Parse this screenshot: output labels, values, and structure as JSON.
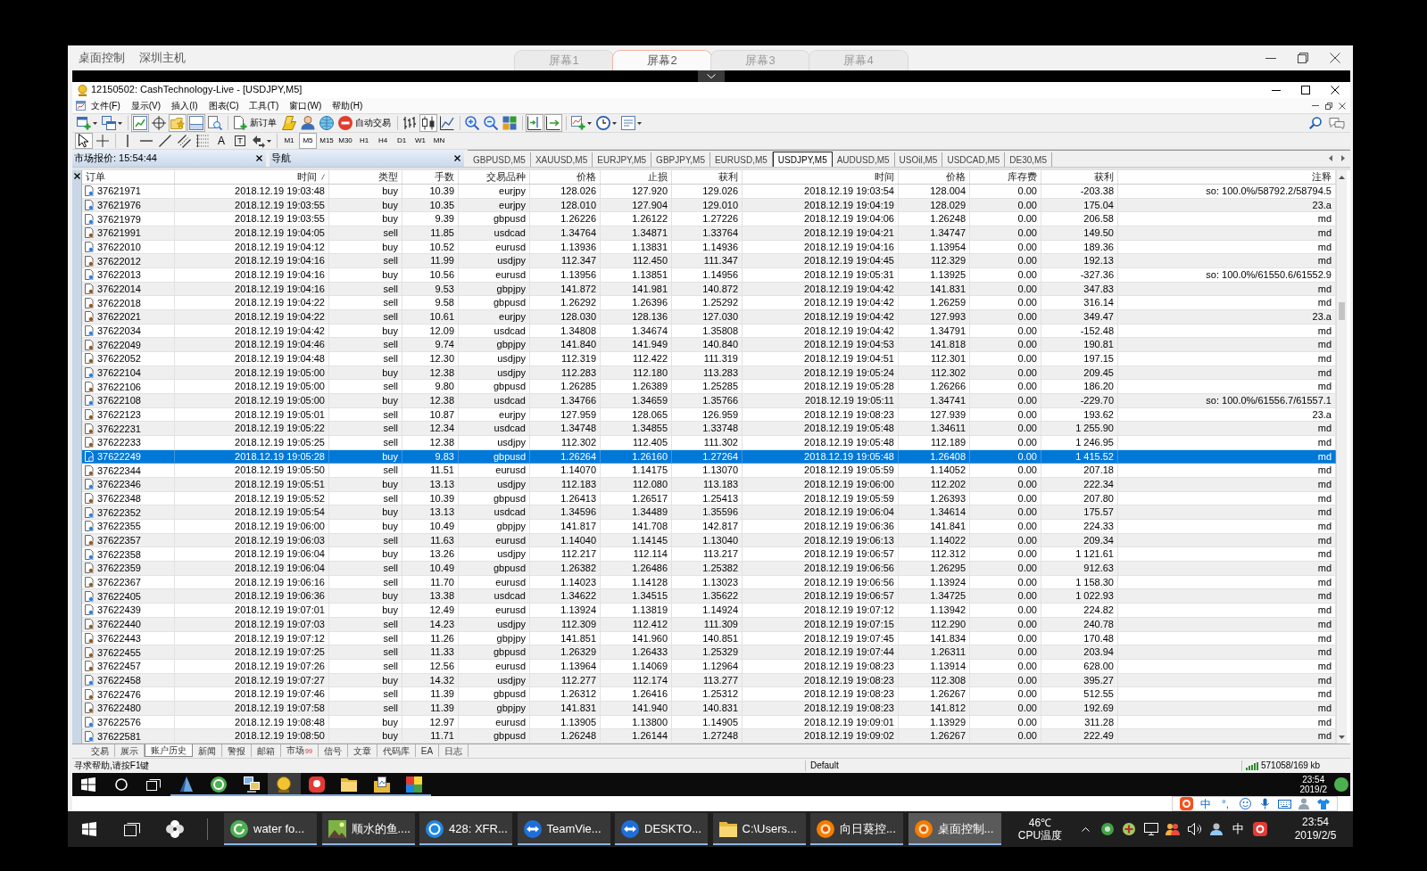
{
  "client": {
    "labels": [
      "桌面控制",
      "深圳主机"
    ],
    "screens": [
      {
        "label": "屏幕1",
        "selected": false
      },
      {
        "label": "屏幕2",
        "selected": true
      },
      {
        "label": "屏幕3",
        "selected": false
      },
      {
        "label": "屏幕4",
        "selected": false
      }
    ]
  },
  "window": {
    "title": "12150502: CashTechnology-Live - [USDJPY,M5]"
  },
  "menu": [
    "文件(F)",
    "显示(V)",
    "插入(I)",
    "图表(C)",
    "工具(T)",
    "窗口(W)",
    "帮助(H)"
  ],
  "toolbar": [
    {
      "pressed": false
    },
    {
      "pressed": false
    },
    {
      "pressed": true
    },
    {
      "pressed": false
    },
    {
      "pressed": true
    },
    {
      "pressed": true
    },
    {
      "pressed": false
    },
    {
      "label": "新订单",
      "pressed": false
    },
    {
      "pressed": false
    },
    {
      "pressed": false
    },
    {
      "pressed": false
    },
    {
      "label": "自动交易",
      "pressed": false
    },
    {
      "pressed": false
    },
    {
      "pressed": true
    },
    {
      "pressed": false
    },
    {
      "pressed": false
    },
    {
      "pressed": false
    },
    {
      "pressed": false
    },
    {
      "pressed": true
    },
    {
      "pressed": true
    },
    {
      "pressed": false
    },
    {
      "pressed": false
    },
    {
      "pressed": false
    }
  ],
  "drawing_tools": [
    {
      "pressed": true
    },
    {
      "pressed": false
    },
    {
      "pressed": false
    },
    {
      "pressed": false
    },
    {
      "pressed": false
    },
    {
      "pressed": false
    },
    {
      "pressed": false
    },
    {
      "glyph": "A",
      "pressed": false
    },
    {
      "glyph": "T",
      "pressed": false
    },
    {
      "pressed": false
    }
  ],
  "timeframes": [
    {
      "label": "M1",
      "selected": false
    },
    {
      "label": "M5",
      "selected": true
    },
    {
      "label": "M15",
      "selected": false
    },
    {
      "label": "M30",
      "selected": false
    },
    {
      "label": "H1",
      "selected": false
    },
    {
      "label": "H4",
      "selected": false
    },
    {
      "label": "D1",
      "selected": false
    },
    {
      "label": "W1",
      "selected": false
    },
    {
      "label": "MN",
      "selected": false
    }
  ],
  "panels": [
    {
      "title": "市场报价: 15:54:44"
    },
    {
      "title": "导航"
    }
  ],
  "chart_tabs": [
    {
      "label": "GBPUSD,M5",
      "selected": false
    },
    {
      "label": "XAUUSD,M5",
      "selected": false
    },
    {
      "label": "EURJPY,M5",
      "selected": false
    },
    {
      "label": "GBPJPY,M5",
      "selected": false
    },
    {
      "label": "EURUSD,M5",
      "selected": false
    },
    {
      "label": "USDJPY,M5",
      "selected": true
    },
    {
      "label": "AUDUSD,M5",
      "selected": false
    },
    {
      "label": "USOil,M5",
      "selected": false
    },
    {
      "label": "USDCAD,M5",
      "selected": false
    },
    {
      "label": "DE30,M5",
      "selected": false
    }
  ],
  "table": {
    "columns": [
      {
        "label": "订单",
        "sorted": false
      },
      {
        "label": "时间",
        "sorted": true
      },
      {
        "label": "类型",
        "sorted": false
      },
      {
        "label": "手数",
        "sorted": false
      },
      {
        "label": "交易品种",
        "sorted": false
      },
      {
        "label": "价格",
        "sorted": false
      },
      {
        "label": "止损",
        "sorted": false
      },
      {
        "label": "获利",
        "sorted": false
      },
      {
        "label": "时间",
        "sorted": false
      },
      {
        "label": "价格",
        "sorted": false
      },
      {
        "label": "库存费",
        "sorted": false
      },
      {
        "label": "获利",
        "sorted": false
      },
      {
        "label": "注释",
        "sorted": false
      }
    ],
    "rows": [
      {
        "kind": "buy",
        "selected": false,
        "cells": [
          "37621971",
          "2018.12.19 19:03:48",
          "buy",
          "10.39",
          "eurjpy",
          "128.026",
          "127.920",
          "129.026",
          "2018.12.19 19:03:54",
          "128.004",
          "0.00",
          "-203.38",
          "so: 100.0%/58792.2/58794.5"
        ]
      },
      {
        "kind": "buy",
        "selected": false,
        "cells": [
          "37621976",
          "2018.12.19 19:03:55",
          "buy",
          "10.35",
          "eurjpy",
          "128.010",
          "127.904",
          "129.010",
          "2018.12.19 19:04:19",
          "128.029",
          "0.00",
          "175.04",
          "23.a"
        ]
      },
      {
        "kind": "buy",
        "selected": false,
        "cells": [
          "37621979",
          "2018.12.19 19:03:55",
          "buy",
          "9.39",
          "gbpusd",
          "1.26226",
          "1.26122",
          "1.27226",
          "2018.12.19 19:04:06",
          "1.26248",
          "0.00",
          "206.58",
          "md"
        ]
      },
      {
        "kind": "sell",
        "selected": false,
        "cells": [
          "37621991",
          "2018.12.19 19:04:05",
          "sell",
          "11.85",
          "usdcad",
          "1.34764",
          "1.34871",
          "1.33764",
          "2018.12.19 19:04:21",
          "1.34747",
          "0.00",
          "149.50",
          "md"
        ]
      },
      {
        "kind": "buy",
        "selected": false,
        "cells": [
          "37622010",
          "2018.12.19 19:04:12",
          "buy",
          "10.52",
          "eurusd",
          "1.13936",
          "1.13831",
          "1.14936",
          "2018.12.19 19:04:16",
          "1.13954",
          "0.00",
          "189.36",
          "md"
        ]
      },
      {
        "kind": "sell",
        "selected": false,
        "cells": [
          "37622012",
          "2018.12.19 19:04:16",
          "sell",
          "11.99",
          "usdjpy",
          "112.347",
          "112.450",
          "111.347",
          "2018.12.19 19:04:45",
          "112.329",
          "0.00",
          "192.13",
          "md"
        ]
      },
      {
        "kind": "buy",
        "selected": false,
        "cells": [
          "37622013",
          "2018.12.19 19:04:16",
          "buy",
          "10.56",
          "eurusd",
          "1.13956",
          "1.13851",
          "1.14956",
          "2018.12.19 19:05:31",
          "1.13925",
          "0.00",
          "-327.36",
          "so: 100.0%/61550.6/61552.9"
        ]
      },
      {
        "kind": "sell",
        "selected": false,
        "cells": [
          "37622014",
          "2018.12.19 19:04:16",
          "sell",
          "9.53",
          "gbpjpy",
          "141.872",
          "141.981",
          "140.872",
          "2018.12.19 19:04:42",
          "141.831",
          "0.00",
          "347.83",
          "md"
        ]
      },
      {
        "kind": "sell",
        "selected": false,
        "cells": [
          "37622018",
          "2018.12.19 19:04:22",
          "sell",
          "9.58",
          "gbpusd",
          "1.26292",
          "1.26396",
          "1.25292",
          "2018.12.19 19:04:42",
          "1.26259",
          "0.00",
          "316.14",
          "md"
        ]
      },
      {
        "kind": "sell",
        "selected": false,
        "cells": [
          "37622021",
          "2018.12.19 19:04:22",
          "sell",
          "10.61",
          "eurjpy",
          "128.030",
          "128.136",
          "127.030",
          "2018.12.19 19:04:42",
          "127.993",
          "0.00",
          "349.47",
          "23.a"
        ]
      },
      {
        "kind": "buy",
        "selected": false,
        "cells": [
          "37622034",
          "2018.12.19 19:04:42",
          "buy",
          "12.09",
          "usdcad",
          "1.34808",
          "1.34674",
          "1.35808",
          "2018.12.19 19:04:42",
          "1.34791",
          "0.00",
          "-152.48",
          "md"
        ]
      },
      {
        "kind": "sell",
        "selected": false,
        "cells": [
          "37622049",
          "2018.12.19 19:04:46",
          "sell",
          "9.74",
          "gbpjpy",
          "141.840",
          "141.949",
          "140.840",
          "2018.12.19 19:04:53",
          "141.818",
          "0.00",
          "190.81",
          "md"
        ]
      },
      {
        "kind": "sell",
        "selected": false,
        "cells": [
          "37622052",
          "2018.12.19 19:04:48",
          "sell",
          "12.30",
          "usdjpy",
          "112.319",
          "112.422",
          "111.319",
          "2018.12.19 19:04:51",
          "112.301",
          "0.00",
          "197.15",
          "md"
        ]
      },
      {
        "kind": "buy",
        "selected": false,
        "cells": [
          "37622104",
          "2018.12.19 19:05:00",
          "buy",
          "12.38",
          "usdjpy",
          "112.283",
          "112.180",
          "113.283",
          "2018.12.19 19:05:24",
          "112.302",
          "0.00",
          "209.45",
          "md"
        ]
      },
      {
        "kind": "sell",
        "selected": false,
        "cells": [
          "37622106",
          "2018.12.19 19:05:00",
          "sell",
          "9.80",
          "gbpusd",
          "1.26285",
          "1.26389",
          "1.25285",
          "2018.12.19 19:05:28",
          "1.26266",
          "0.00",
          "186.20",
          "md"
        ]
      },
      {
        "kind": "buy",
        "selected": false,
        "cells": [
          "37622108",
          "2018.12.19 19:05:00",
          "buy",
          "12.38",
          "usdcad",
          "1.34766",
          "1.34659",
          "1.35766",
          "2018.12.19 19:05:11",
          "1.34741",
          "0.00",
          "-229.70",
          "so: 100.0%/61556.7/61557.1"
        ]
      },
      {
        "kind": "sell",
        "selected": false,
        "cells": [
          "37622123",
          "2018.12.19 19:05:01",
          "sell",
          "10.87",
          "eurjpy",
          "127.959",
          "128.065",
          "126.959",
          "2018.12.19 19:08:23",
          "127.939",
          "0.00",
          "193.62",
          "23.a"
        ]
      },
      {
        "kind": "sell",
        "selected": false,
        "cells": [
          "37622231",
          "2018.12.19 19:05:22",
          "sell",
          "12.34",
          "usdcad",
          "1.34748",
          "1.34855",
          "1.33748",
          "2018.12.19 19:05:48",
          "1.34611",
          "0.00",
          "1 255.90",
          "md"
        ]
      },
      {
        "kind": "sell",
        "selected": false,
        "cells": [
          "37622233",
          "2018.12.19 19:05:25",
          "sell",
          "12.38",
          "usdjpy",
          "112.302",
          "112.405",
          "111.302",
          "2018.12.19 19:05:48",
          "112.189",
          "0.00",
          "1 246.95",
          "md"
        ]
      },
      {
        "kind": "buy",
        "selected": true,
        "cells": [
          "37622249",
          "2018.12.19 19:05:28",
          "buy",
          "9.83",
          "gbpusd",
          "1.26264",
          "1.26160",
          "1.27264",
          "2018.12.19 19:05:48",
          "1.26408",
          "0.00",
          "1 415.52",
          "md"
        ]
      },
      {
        "kind": "sell",
        "selected": false,
        "cells": [
          "37622344",
          "2018.12.19 19:05:50",
          "sell",
          "11.51",
          "eurusd",
          "1.14070",
          "1.14175",
          "1.13070",
          "2018.12.19 19:05:59",
          "1.14052",
          "0.00",
          "207.18",
          "md"
        ]
      },
      {
        "kind": "buy",
        "selected": false,
        "cells": [
          "37622346",
          "2018.12.19 19:05:51",
          "buy",
          "13.13",
          "usdjpy",
          "112.183",
          "112.080",
          "113.183",
          "2018.12.19 19:06:00",
          "112.202",
          "0.00",
          "222.34",
          "md"
        ]
      },
      {
        "kind": "sell",
        "selected": false,
        "cells": [
          "37622348",
          "2018.12.19 19:05:52",
          "sell",
          "10.39",
          "gbpusd",
          "1.26413",
          "1.26517",
          "1.25413",
          "2018.12.19 19:05:59",
          "1.26393",
          "0.00",
          "207.80",
          "md"
        ]
      },
      {
        "kind": "buy",
        "selected": false,
        "cells": [
          "37622352",
          "2018.12.19 19:05:54",
          "buy",
          "13.13",
          "usdcad",
          "1.34596",
          "1.34489",
          "1.35596",
          "2018.12.19 19:06:04",
          "1.34614",
          "0.00",
          "175.57",
          "md"
        ]
      },
      {
        "kind": "buy",
        "selected": false,
        "cells": [
          "37622355",
          "2018.12.19 19:06:00",
          "buy",
          "10.49",
          "gbpjpy",
          "141.817",
          "141.708",
          "142.817",
          "2018.12.19 19:06:36",
          "141.841",
          "0.00",
          "224.33",
          "md"
        ]
      },
      {
        "kind": "sell",
        "selected": false,
        "cells": [
          "37622357",
          "2018.12.19 19:06:03",
          "sell",
          "11.63",
          "eurusd",
          "1.14040",
          "1.14145",
          "1.13040",
          "2018.12.19 19:06:13",
          "1.14022",
          "0.00",
          "209.34",
          "md"
        ]
      },
      {
        "kind": "buy",
        "selected": false,
        "cells": [
          "37622358",
          "2018.12.19 19:06:04",
          "buy",
          "13.26",
          "usdjpy",
          "112.217",
          "112.114",
          "113.217",
          "2018.12.19 19:06:57",
          "112.312",
          "0.00",
          "1 121.61",
          "md"
        ]
      },
      {
        "kind": "sell",
        "selected": false,
        "cells": [
          "37622359",
          "2018.12.19 19:06:04",
          "sell",
          "10.49",
          "gbpusd",
          "1.26382",
          "1.26486",
          "1.25382",
          "2018.12.19 19:06:56",
          "1.26295",
          "0.00",
          "912.63",
          "md"
        ]
      },
      {
        "kind": "sell",
        "selected": false,
        "cells": [
          "37622367",
          "2018.12.19 19:06:16",
          "sell",
          "11.70",
          "eurusd",
          "1.14023",
          "1.14128",
          "1.13023",
          "2018.12.19 19:06:56",
          "1.13924",
          "0.00",
          "1 158.30",
          "md"
        ]
      },
      {
        "kind": "buy",
        "selected": false,
        "cells": [
          "37622405",
          "2018.12.19 19:06:36",
          "buy",
          "13.38",
          "usdcad",
          "1.34622",
          "1.34515",
          "1.35622",
          "2018.12.19 19:06:57",
          "1.34725",
          "0.00",
          "1 022.93",
          "md"
        ]
      },
      {
        "kind": "buy",
        "selected": false,
        "cells": [
          "37622439",
          "2018.12.19 19:07:01",
          "buy",
          "12.49",
          "eurusd",
          "1.13924",
          "1.13819",
          "1.14924",
          "2018.12.19 19:07:12",
          "1.13942",
          "0.00",
          "224.82",
          "md"
        ]
      },
      {
        "kind": "sell",
        "selected": false,
        "cells": [
          "37622440",
          "2018.12.19 19:07:03",
          "sell",
          "14.23",
          "usdjpy",
          "112.309",
          "112.412",
          "111.309",
          "2018.12.19 19:07:15",
          "112.290",
          "0.00",
          "240.78",
          "md"
        ]
      },
      {
        "kind": "sell",
        "selected": false,
        "cells": [
          "37622443",
          "2018.12.19 19:07:12",
          "sell",
          "11.26",
          "gbpjpy",
          "141.851",
          "141.960",
          "140.851",
          "2018.12.19 19:07:45",
          "141.834",
          "0.00",
          "170.48",
          "md"
        ]
      },
      {
        "kind": "sell",
        "selected": false,
        "cells": [
          "37622455",
          "2018.12.19 19:07:25",
          "sell",
          "11.33",
          "gbpusd",
          "1.26329",
          "1.26433",
          "1.25329",
          "2018.12.19 19:07:44",
          "1.26311",
          "0.00",
          "203.94",
          "md"
        ]
      },
      {
        "kind": "sell",
        "selected": false,
        "cells": [
          "37622457",
          "2018.12.19 19:07:26",
          "sell",
          "12.56",
          "eurusd",
          "1.13964",
          "1.14069",
          "1.12964",
          "2018.12.19 19:08:23",
          "1.13914",
          "0.00",
          "628.00",
          "md"
        ]
      },
      {
        "kind": "buy",
        "selected": false,
        "cells": [
          "37622458",
          "2018.12.19 19:07:27",
          "buy",
          "14.32",
          "usdjpy",
          "112.277",
          "112.174",
          "113.277",
          "2018.12.19 19:08:23",
          "112.308",
          "0.00",
          "395.27",
          "md"
        ]
      },
      {
        "kind": "sell",
        "selected": false,
        "cells": [
          "37622476",
          "2018.12.19 19:07:46",
          "sell",
          "11.39",
          "gbpusd",
          "1.26312",
          "1.26416",
          "1.25312",
          "2018.12.19 19:08:23",
          "1.26267",
          "0.00",
          "512.55",
          "md"
        ]
      },
      {
        "kind": "sell",
        "selected": false,
        "cells": [
          "37622480",
          "2018.12.19 19:07:58",
          "sell",
          "11.39",
          "gbpjpy",
          "141.831",
          "141.940",
          "140.831",
          "2018.12.19 19:08:23",
          "141.812",
          "0.00",
          "192.69",
          "md"
        ]
      },
      {
        "kind": "buy",
        "selected": false,
        "cells": [
          "37622576",
          "2018.12.19 19:08:48",
          "buy",
          "12.97",
          "eurusd",
          "1.13905",
          "1.13800",
          "1.14905",
          "2018.12.19 19:09:01",
          "1.13929",
          "0.00",
          "311.28",
          "md"
        ]
      },
      {
        "kind": "buy",
        "selected": false,
        "cells": [
          "37622581",
          "2018.12.19 19:08:50",
          "buy",
          "11.71",
          "gbpusd",
          "1.26248",
          "1.26144",
          "1.27248",
          "2018.12.19 19:09:02",
          "1.26267",
          "0.00",
          "222.49",
          "md"
        ]
      }
    ]
  },
  "terminal_tabs": [
    {
      "label": "交易",
      "selected": false
    },
    {
      "label": "展示",
      "selected": false
    },
    {
      "label": "账户历史",
      "selected": true
    },
    {
      "label": "新闻",
      "selected": false
    },
    {
      "label": "警报",
      "selected": false
    },
    {
      "label": "邮箱",
      "selected": false
    },
    {
      "label": "市场",
      "badge": "99",
      "selected": false
    },
    {
      "label": "信号",
      "selected": false
    },
    {
      "label": "文章",
      "selected": false
    },
    {
      "label": "代码库",
      "selected": false
    },
    {
      "label": "EA",
      "selected": false
    },
    {
      "label": "日志",
      "selected": false
    }
  ],
  "status_bar": {
    "hint": "寻求帮助,请按F1键",
    "profile": "Default",
    "traffic": "571058/169 kb"
  },
  "remote_taskbar": {
    "apps": [
      {
        "running": true,
        "selected": false
      },
      {
        "running": true,
        "selected": false
      },
      {
        "running": true,
        "selected": false
      },
      {
        "running": true,
        "selected": true
      },
      {
        "running": true,
        "selected": false
      },
      {
        "running": true,
        "selected": false
      },
      {
        "running": true,
        "selected": false
      },
      {
        "running": true,
        "selected": false
      }
    ],
    "time": "23:54",
    "date": "2019/2"
  },
  "ime_bar": {
    "mode": "中",
    "punctuation": "°,"
  },
  "taskbar": {
    "buttons": [
      {
        "label": "water fo...",
        "selected": false
      },
      {
        "label": "顺水的鱼....",
        "selected": false
      },
      {
        "label": "428: XFR...",
        "selected": false
      },
      {
        "label": "TeamVie...",
        "selected": false
      },
      {
        "label": "DESKTO...",
        "selected": false
      },
      {
        "label": "C:\\Users...",
        "selected": false
      },
      {
        "label": "向日葵控...",
        "selected": false
      },
      {
        "label": "桌面控制...",
        "selected": true
      }
    ],
    "temperature": "46℃",
    "sensor": "CPU温度",
    "ime": "中",
    "time": "23:54",
    "date": "2019/2/5"
  }
}
